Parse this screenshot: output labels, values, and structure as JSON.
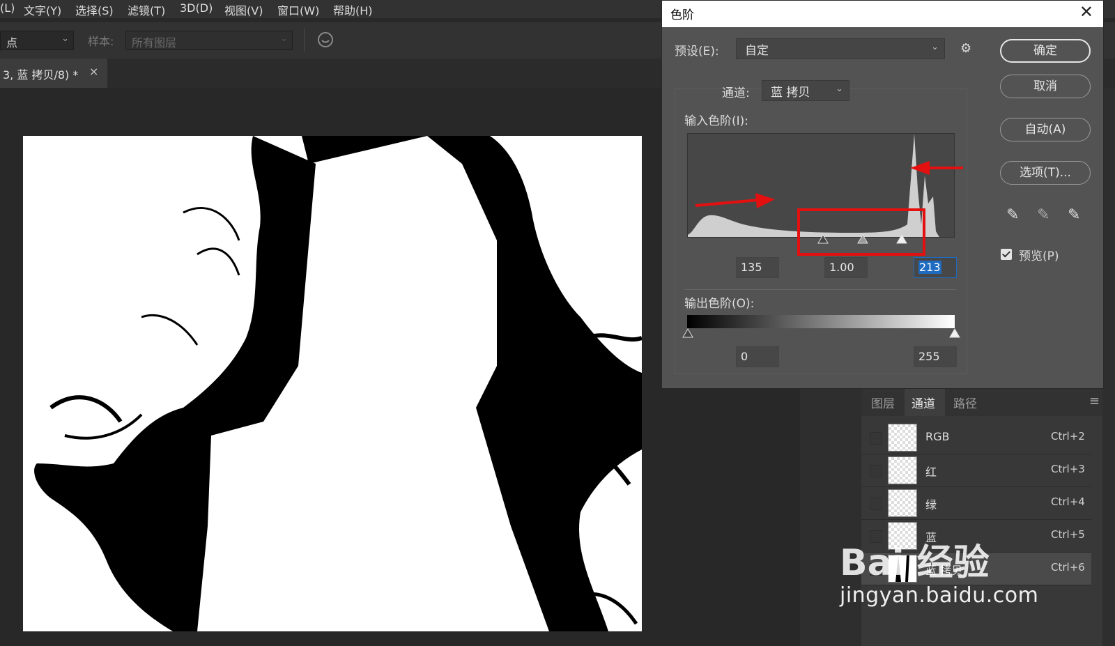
{
  "menubar": {
    "items": [
      "(L)",
      "文字(Y)",
      "选择(S)",
      "滤镜(T)",
      "3D(D)",
      "视图(V)",
      "窗口(W)",
      "帮助(H)"
    ]
  },
  "options_bar": {
    "point_select": "点",
    "sample_label": "样本:",
    "sample_value": "所有图层"
  },
  "document_tab": {
    "title": "3, 蓝 拷贝/8) *",
    "close": "×"
  },
  "levels_dialog": {
    "title": "色阶",
    "close": "✕",
    "preset_label": "预设(E):",
    "preset_value": "自定",
    "channel_label": "通道:",
    "channel_value": "蓝 拷贝",
    "input_levels_label": "输入色阶(I):",
    "input_black": "135",
    "input_gamma": "1.00",
    "input_white": "213",
    "output_levels_label": "输出色阶(O):",
    "output_black": "0",
    "output_white": "255",
    "buttons": {
      "ok": "确定",
      "cancel": "取消",
      "auto": "自动(A)",
      "options": "选项(T)..."
    },
    "preview_label": "预览(P)",
    "preview_checked": true
  },
  "channels_panel": {
    "tabs": [
      "图层",
      "通道",
      "路径"
    ],
    "active_tab": "通道",
    "channels": [
      {
        "name": "RGB",
        "shortcut": "Ctrl+2"
      },
      {
        "name": "红",
        "shortcut": "Ctrl+3"
      },
      {
        "name": "绿",
        "shortcut": "Ctrl+4"
      },
      {
        "name": "蓝",
        "shortcut": "Ctrl+5"
      },
      {
        "name": "蓝 拷贝",
        "shortcut": "Ctrl+6"
      }
    ]
  },
  "watermark": {
    "logo": "Bai 经验",
    "url": "jingyan.baidu.com"
  },
  "colors": {
    "annotation_red": "#e41010",
    "selection_blue": "#1e6bc0"
  }
}
